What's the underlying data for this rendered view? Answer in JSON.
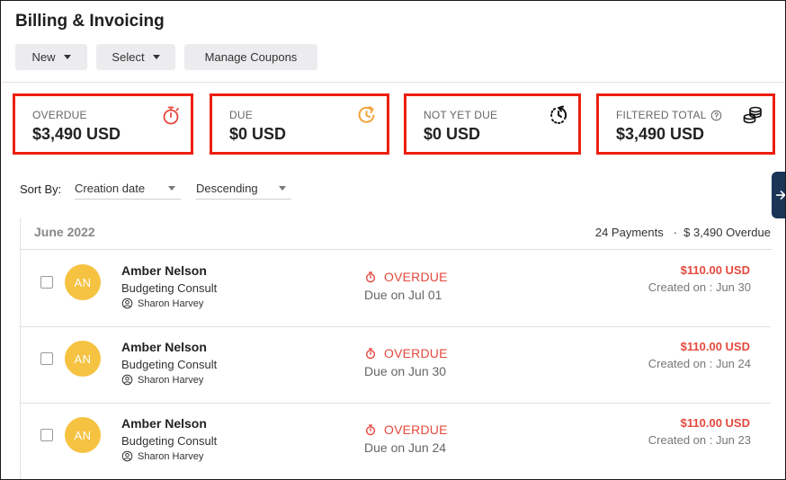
{
  "page": {
    "title": "Billing & Invoicing"
  },
  "toolbar": {
    "new_label": "New",
    "select_label": "Select",
    "coupons_label": "Manage Coupons"
  },
  "summary": {
    "overdue": {
      "label": "OVERDUE",
      "value": "$3,490 USD",
      "icon": "stopwatch-icon",
      "color": "#e5493d"
    },
    "due": {
      "label": "DUE",
      "value": "$0 USD",
      "icon": "clock-refresh-icon",
      "color": "#f2a33a"
    },
    "not_yet_due": {
      "label": "NOT YET DUE",
      "value": "$0 USD",
      "icon": "dashed-clock-icon",
      "color": "#111111"
    },
    "filtered_total": {
      "label": "FILTERED TOTAL",
      "value": "$3,490 USD",
      "icon": "coins-stack-icon",
      "color": "#111111"
    }
  },
  "sort": {
    "label": "Sort By:",
    "field": "Creation date",
    "order": "Descending"
  },
  "group": {
    "title": "June 2022",
    "payments": "24 Payments",
    "separator": "·",
    "overdue_total": "$ 3,490 Overdue"
  },
  "invoices": [
    {
      "initials": "AN",
      "client": "Amber Nelson",
      "service": "Budgeting Consult",
      "staff": "Sharon Harvey",
      "status": "OVERDUE",
      "due": "Due on Jul 01",
      "amount": "$110.00 USD",
      "created": "Created on : Jun 30"
    },
    {
      "initials": "AN",
      "client": "Amber Nelson",
      "service": "Budgeting Consult",
      "staff": "Sharon Harvey",
      "status": "OVERDUE",
      "due": "Due on Jun 30",
      "amount": "$110.00 USD",
      "created": "Created on : Jun 24"
    },
    {
      "initials": "AN",
      "client": "Amber Nelson",
      "service": "Budgeting Consult",
      "staff": "Sharon Harvey",
      "status": "OVERDUE",
      "due": "Due on Jun 24",
      "amount": "$110.00 USD",
      "created": "Created on : Jun 23"
    }
  ],
  "colors": {
    "highlight_border": "#ec1f10",
    "overdue_red": "#e5493d",
    "avatar_yellow": "#f6c241",
    "side_tab_navy": "#1b3557"
  }
}
